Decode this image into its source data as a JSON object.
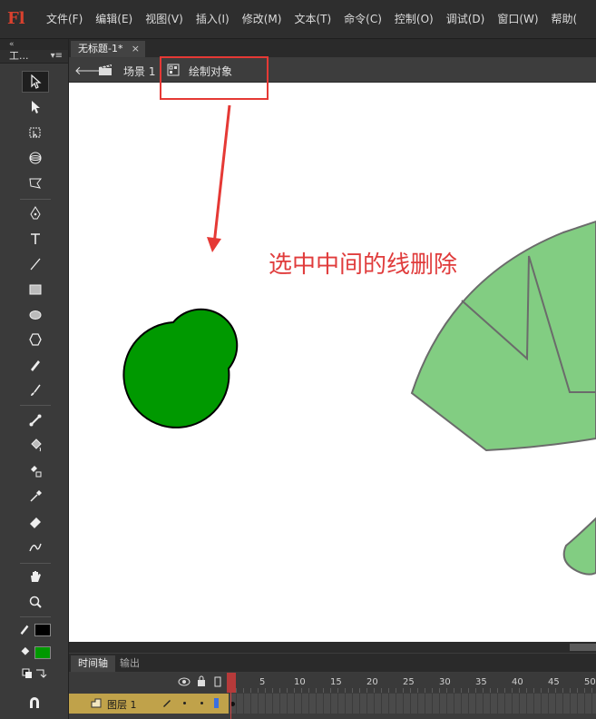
{
  "app": {
    "logo": "Fl"
  },
  "menu": [
    "文件(F)",
    "编辑(E)",
    "视图(V)",
    "插入(I)",
    "修改(M)",
    "文本(T)",
    "命令(C)",
    "控制(O)",
    "调试(D)",
    "窗口(W)",
    "帮助("
  ],
  "toolbox": {
    "title": "工...",
    "options_icon": "▾≡"
  },
  "document": {
    "tab_title": "无标题-1*",
    "tab_close": "×"
  },
  "editbar": {
    "scene_label": "场景 1",
    "object_label": "绘制对象"
  },
  "stage": {
    "annotation": "选中中间的线删除"
  },
  "timeline": {
    "tabs": [
      "时间轴",
      "输出"
    ],
    "frame_numbers": [
      "1",
      "5",
      "10",
      "15",
      "20",
      "25",
      "30",
      "35",
      "40",
      "45",
      "50"
    ],
    "layer_name": "图层 1"
  },
  "colors": {
    "stroke": "#000000",
    "fill": "#009900",
    "accent": "#e53935",
    "leaf": "#82cd82"
  }
}
